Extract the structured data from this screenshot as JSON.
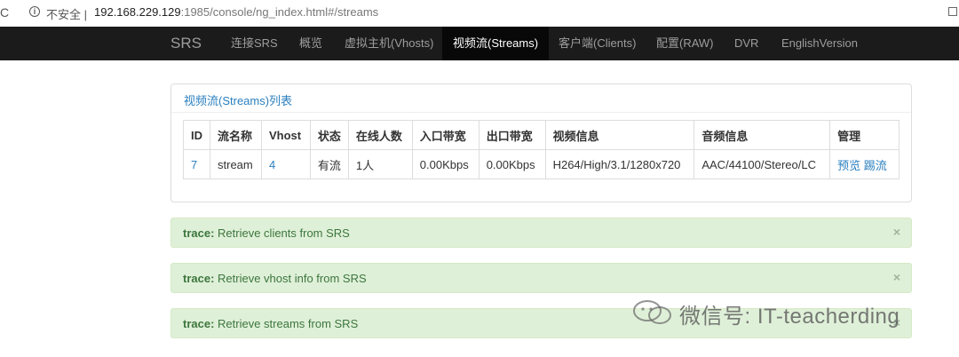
{
  "browser": {
    "insecure_label": "不安全",
    "url_host": "192.168.229.129",
    "url_path": ":1985/console/ng_index.html#/streams"
  },
  "navbar": {
    "brand": "SRS",
    "items": [
      {
        "label": "连接SRS"
      },
      {
        "label": "概览"
      },
      {
        "label": "虚拟主机(Vhosts)"
      },
      {
        "label": "视频流(Streams)",
        "active": true
      },
      {
        "label": "客户端(Clients)"
      },
      {
        "label": "配置(RAW)"
      },
      {
        "label": "DVR"
      },
      {
        "label": "EnglishVersion"
      }
    ]
  },
  "panel": {
    "title": "视频流(Streams)列表",
    "columns": [
      "ID",
      "流名称",
      "Vhost",
      "状态",
      "在线人数",
      "入口带宽",
      "出口带宽",
      "视频信息",
      "音频信息",
      "管理"
    ],
    "rows": [
      {
        "id": "7",
        "name": "stream",
        "vhost": "4",
        "status": "有流",
        "clients": "1人",
        "in_bw": "0.00Kbps",
        "out_bw": "0.00Kbps",
        "video": "H264/High/3.1/1280x720",
        "audio": "AAC/44100/Stereo/LC",
        "action_preview": "预览",
        "action_kick": "踢流"
      }
    ]
  },
  "alerts": [
    {
      "prefix": "trace:",
      "text": " Retrieve clients from SRS"
    },
    {
      "prefix": "trace:",
      "text": " Retrieve vhost info from SRS"
    },
    {
      "prefix": "trace:",
      "text": " Retrieve streams from SRS"
    }
  ],
  "alert_close": "×",
  "watermark": "微信号: IT-teacherding",
  "colors": {
    "navbar_bg": "#1b1b1b",
    "link": "#2a7fbf",
    "alert_bg": "#dff0d8",
    "alert_text": "#3c763d"
  }
}
